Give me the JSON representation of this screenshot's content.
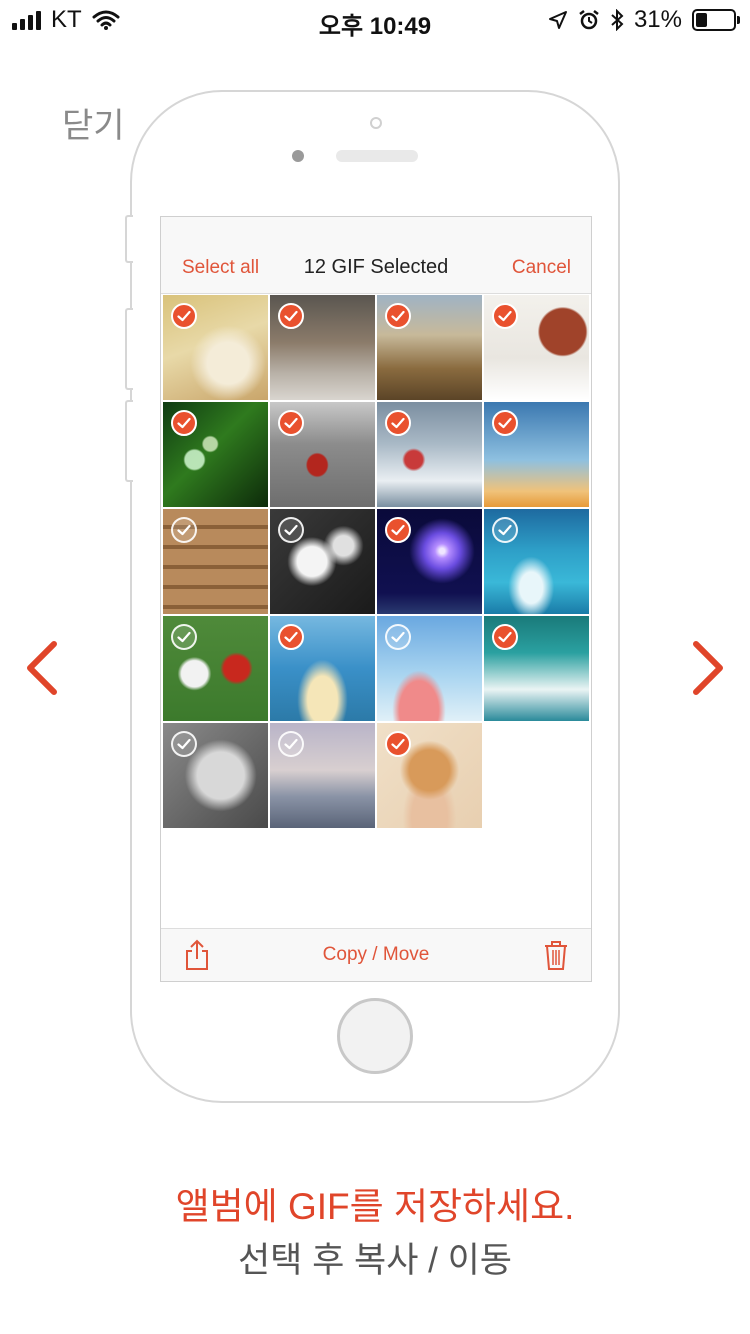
{
  "status_bar": {
    "carrier": "KT",
    "time": "오후 10:49",
    "battery_percent": "31%",
    "battery_level": 0.31
  },
  "close_label": "닫기",
  "screen": {
    "select_all": "Select all",
    "title": "12 GIF Selected",
    "cancel": "Cancel",
    "copy_move": "Copy / Move",
    "thumbnails": [
      {
        "subject": "party-cat",
        "selected": true
      },
      {
        "subject": "clock-tower-street",
        "selected": true
      },
      {
        "subject": "desert-biker",
        "selected": true
      },
      {
        "subject": "hot-air-balloon",
        "selected": true
      },
      {
        "subject": "soap-bubbles",
        "selected": true
      },
      {
        "subject": "red-tram",
        "selected": true
      },
      {
        "subject": "windsurfer",
        "selected": true
      },
      {
        "subject": "silhouette-jump",
        "selected": true
      },
      {
        "subject": "cat-on-stairs",
        "selected": false
      },
      {
        "subject": "white-feathers",
        "selected": false
      },
      {
        "subject": "fireworks",
        "selected": true
      },
      {
        "subject": "ocean-dive",
        "selected": false
      },
      {
        "subject": "soccer-players",
        "selected": false
      },
      {
        "subject": "wakeboarder",
        "selected": true
      },
      {
        "subject": "frame-tablets-man",
        "selected": false
      },
      {
        "subject": "wave-surfer",
        "selected": true
      },
      {
        "subject": "mustache-man",
        "selected": false
      },
      {
        "subject": "beach-jumper",
        "selected": false
      },
      {
        "subject": "kitten-in-hand",
        "selected": true
      }
    ]
  },
  "caption": {
    "main": "앨범에 GIF를 저장하세요.",
    "sub": "선택 후 복사 / 이동"
  },
  "colors": {
    "accent": "#E0553A",
    "check": "#E9512E",
    "caption_main": "#E0452A"
  }
}
